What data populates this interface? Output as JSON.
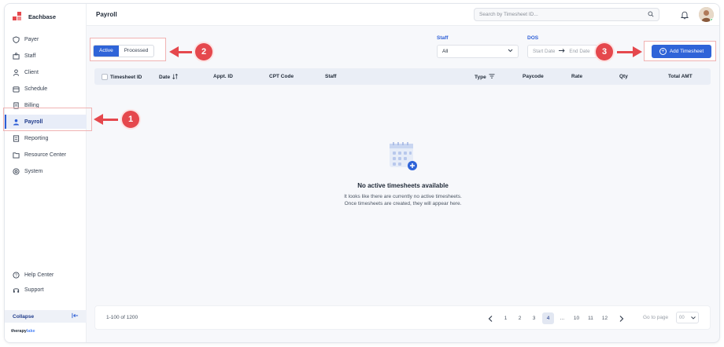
{
  "app": {
    "brand": "Eachbase",
    "footer_brand_a": "therapy",
    "footer_brand_b": "lake"
  },
  "sidebar": {
    "items": [
      {
        "label": "Payer",
        "icon": "shield-icon"
      },
      {
        "label": "Staff",
        "icon": "staff-icon"
      },
      {
        "label": "Client",
        "icon": "client-icon"
      },
      {
        "label": "Schedule",
        "icon": "calendar-icon"
      },
      {
        "label": "Billing",
        "icon": "billing-icon"
      },
      {
        "label": "Payroll",
        "icon": "payroll-icon",
        "active": true
      },
      {
        "label": "Reporting",
        "icon": "report-icon"
      },
      {
        "label": "Resource Center",
        "icon": "folder-icon"
      },
      {
        "label": "System",
        "icon": "system-icon"
      }
    ],
    "help": "Help Center",
    "support": "Support",
    "collapse": "Collapse"
  },
  "header": {
    "title": "Payroll",
    "search_placeholder": "Search by Timesheet ID..."
  },
  "toolbar": {
    "tabs": [
      "Active",
      "Processed"
    ],
    "staff_label": "Staff",
    "staff_value": "All",
    "dos_label": "DOS",
    "start_placeholder": "Start Date",
    "end_placeholder": "End Date",
    "add_label": "Add Timesheet"
  },
  "table": {
    "columns": [
      "Timesheet ID",
      "Date",
      "Appt. ID",
      "CPT Code",
      "Staff",
      "Type",
      "Paycode",
      "Rate",
      "Qty",
      "Total AMT"
    ]
  },
  "empty": {
    "title": "No active timesheets available",
    "line1": "It looks like there are currently no active timesheets.",
    "line2": "Once timesheets are created, they will appear here."
  },
  "pagination": {
    "range": "1-100 of 1200",
    "pages": [
      "1",
      "2",
      "3",
      "4",
      "...",
      "10",
      "11",
      "12"
    ],
    "current": "4",
    "goto_label": "Go to page",
    "goto_value": "00"
  },
  "callouts": [
    "1",
    "2",
    "3"
  ],
  "colors": {
    "accent": "#2f64d8",
    "annotation": "#e5484d"
  }
}
